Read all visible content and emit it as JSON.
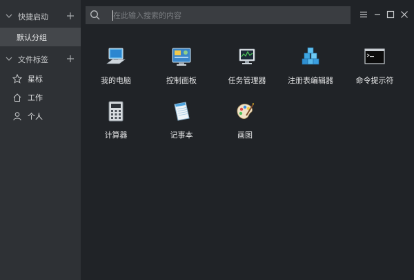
{
  "sidebar": {
    "quick_launch": {
      "label": "快捷启动",
      "groups": [
        {
          "label": "默认分组"
        }
      ]
    },
    "file_tags": {
      "label": "文件标签",
      "items": [
        {
          "label": "星标",
          "icon": "star-icon"
        },
        {
          "label": "工作",
          "icon": "home-icon"
        },
        {
          "label": "个人",
          "icon": "person-icon"
        }
      ]
    }
  },
  "search": {
    "placeholder": "在此输入搜索的内容"
  },
  "apps": [
    {
      "label": "我的电脑",
      "icon": "computer-icon"
    },
    {
      "label": "控制面板",
      "icon": "control-panel-icon"
    },
    {
      "label": "任务管理器",
      "icon": "task-manager-icon"
    },
    {
      "label": "注册表编辑器",
      "icon": "registry-editor-icon"
    },
    {
      "label": "命令提示符",
      "icon": "command-prompt-icon"
    },
    {
      "label": "计算器",
      "icon": "calculator-icon"
    },
    {
      "label": "记事本",
      "icon": "notepad-icon"
    },
    {
      "label": "画图",
      "icon": "paint-icon"
    }
  ],
  "theme": {
    "sidebar_bg": "#2e3135",
    "main_bg": "#202327",
    "selected_bg": "#44474b",
    "search_bg": "#3a3d41"
  }
}
